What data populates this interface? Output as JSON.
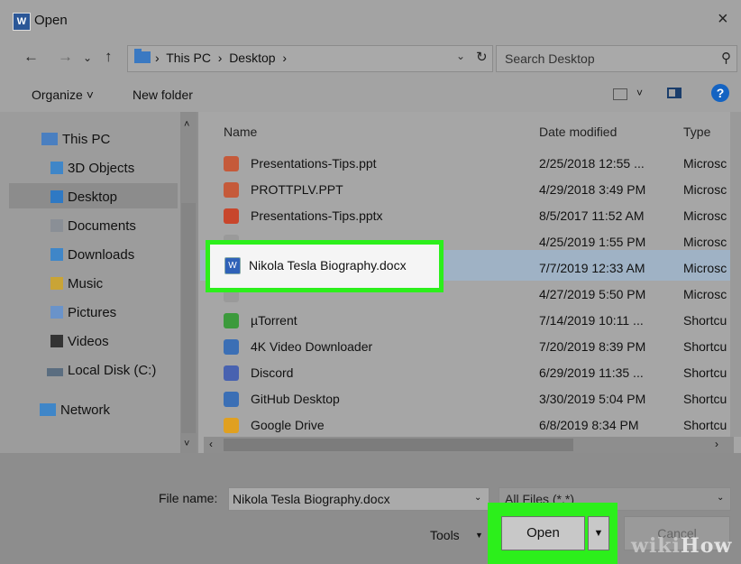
{
  "window": {
    "title": "Open",
    "close": "×"
  },
  "nav": {
    "back": "←",
    "forward": "→",
    "recent": "⌄",
    "up": "↑",
    "address": "›  This PC  ›  Desktop  ›",
    "address_chevron": "⌄",
    "refresh": "↻",
    "search_placeholder": "Search Desktop",
    "search_icon": "⚲"
  },
  "toolbar": {
    "organize": "Organize ˅",
    "new_folder": "New folder",
    "view_drop": "˅",
    "help": "?"
  },
  "sidebar": {
    "items": [
      {
        "label": "This PC",
        "icon": "pc-icon"
      },
      {
        "label": "3D Objects",
        "icon": "3d-objects-icon"
      },
      {
        "label": "Desktop",
        "icon": "folder-icon",
        "selected": true
      },
      {
        "label": "Documents",
        "icon": "documents-icon"
      },
      {
        "label": "Downloads",
        "icon": "downloads-icon"
      },
      {
        "label": "Music",
        "icon": "music-icon"
      },
      {
        "label": "Pictures",
        "icon": "pictures-icon"
      },
      {
        "label": "Videos",
        "icon": "videos-icon"
      },
      {
        "label": "Local Disk (C:)",
        "icon": "disk-icon"
      },
      {
        "label": "Network",
        "icon": "network-icon"
      }
    ],
    "scroll_up": "˄",
    "scroll_down": "˅"
  },
  "files": {
    "columns": {
      "name": "Name",
      "date": "Date modified",
      "type": "Type"
    },
    "rows": [
      {
        "name": "Presentations-Tips.ppt",
        "date": "2/25/2018 12:55 ...",
        "type": "Microsc",
        "icon_color": "#c55a3a"
      },
      {
        "name": "PROTTPLV.PPT",
        "date": "4/29/2018 3:49 PM",
        "type": "Microsc",
        "icon_color": "#c55a3a"
      },
      {
        "name": "Presentations-Tips.pptx",
        "date": "8/5/2017 11:52 AM",
        "type": "Microsc",
        "icon_color": "#c8462c"
      },
      {
        "name": "",
        "date": "4/25/2019 1:55 PM",
        "type": "Microsc",
        "icon_color": "#9a9a9a"
      },
      {
        "name": "",
        "date": "7/7/2019 12:33 AM",
        "type": "Microsc",
        "icon_color": "#2f62b8"
      },
      {
        "name": "",
        "date": "4/27/2019 5:50 PM",
        "type": "Microsc",
        "icon_color": "#9a9a9a"
      },
      {
        "name": "µTorrent",
        "date": "7/14/2019 10:11 ...",
        "type": "Shortcu",
        "icon_color": "#3c9a3c"
      },
      {
        "name": "4K Video Downloader",
        "date": "7/20/2019 8:39 PM",
        "type": "Shortcu",
        "icon_color": "#3b6fb5"
      },
      {
        "name": "Discord",
        "date": "6/29/2019 11:35 ...",
        "type": "Shortcu",
        "icon_color": "#4862b0"
      },
      {
        "name": "GitHub Desktop",
        "date": "3/30/2019 5:04 PM",
        "type": "Shortcu",
        "icon_color": "#3b6fb5"
      },
      {
        "name": "Google Drive",
        "date": "6/8/2019 8:34 PM",
        "type": "Shortcu",
        "icon_color": "#e0a020"
      }
    ],
    "selected_name": "Nikola Tesla Biography.docx",
    "selected_icon_glyph": "W",
    "hscroll_left": "‹",
    "hscroll_right": "›"
  },
  "footer": {
    "file_name_label": "File name:",
    "file_name_value": "Nikola Tesla Biography.docx",
    "file_name_drop": "⌄",
    "filter_value": "All Files (*.*)",
    "filter_drop": "⌄",
    "tools": "Tools",
    "tools_drop": "▼",
    "open": "Open",
    "open_drop": "▼",
    "cancel": "Cancel"
  },
  "watermark": {
    "wiki": "wiki",
    "how": "How"
  },
  "colors": {
    "highlight": "#2cef1b",
    "selection": "#9fb2c5"
  }
}
